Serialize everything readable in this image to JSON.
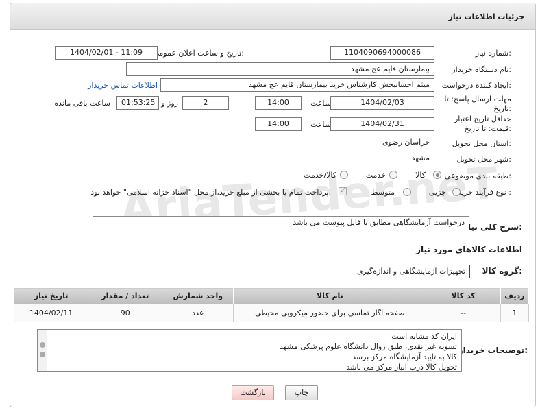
{
  "panel": {
    "title": "جزئیات اطلاعات نیاز"
  },
  "labels": {
    "need_number": "شماره نیاز:",
    "announce_datetime": "تاریخ و ساعت اعلان عمومی:",
    "buyer_org": "نام دستگاه خریدار:",
    "requester": "ایجاد کننده درخواست:",
    "reply_deadline": "مهلت ارسال پاسخ: تا تاریخ:",
    "price_validity": "حداقل تاریخ اعتبار قیمت: تا تاریخ:",
    "time_word": "ساعت",
    "day_and": "روز و",
    "remaining": "ساعت باقی مانده",
    "province": "استان محل تحویل:",
    "city": "شهر محل تحویل:",
    "category": "طبقه بندی موضوعی:",
    "purchase_type": "نوع فرآیند خرید :",
    "description": "شرح کلی نیاز:",
    "items_header": "اطلاعات کالاهای مورد نیاز",
    "goods_group": "گروه کالا:",
    "buyer_notes": "توضیحات خریدار:"
  },
  "values": {
    "need_number": "1104090694000086",
    "announce_datetime": "1404/02/01 - 11:09",
    "buyer_org": "بیمارستان قایم  عج  مشهد",
    "requester": "میثم احسانبخش کارشناس خرید بیمارستان قایم  عج  مشهد",
    "contact_link": "اطلاعات تماس خریدار",
    "reply_date": "1404/02/03",
    "reply_time": "14:00",
    "reply_days": "2",
    "reply_remaining": "01:53:25",
    "validity_date": "1404/02/31",
    "validity_time": "14:00",
    "province": "خراسان رضوی",
    "city": "مشهد",
    "description": "درخواست آزمایشگاهی مطابق با فایل پیوست می باشد",
    "goods_group": "تجهیزات آزمایشگاهی و اندازه‌گیری"
  },
  "category_options": [
    "کالا",
    "خدمت",
    "کالا/خدمت"
  ],
  "category_selected": "کالا",
  "purchase_options": [
    "جزیی",
    "متوسط"
  ],
  "purchase_note": "پرداخت تمام یا بخشی از مبلغ خرید،از محل \"اسناد خزانه اسلامی\" خواهد بود.",
  "watermark": "AriaTender.neT",
  "table": {
    "headers": [
      "ردیف",
      "کد کالا",
      "نام کالا",
      "واحد شمارش",
      "تعداد / مقدار",
      "تاریخ نیاز"
    ],
    "rows": [
      [
        "1",
        "--",
        "صفحه آگار تماسی برای حضور میکروبی محیطی",
        "عدد",
        "90",
        "1404/02/11"
      ]
    ]
  },
  "notes_lines": [
    "ایران کد مشابه است",
    "تسویه غیر نقدی، طبق روال دانشگاه علوم پزشکی مشهد",
    "کالا به تایید آزمایشگاه مرکز برسد",
    "تحویل کالا درب انبار مرکز می باشد"
  ],
  "buttons": {
    "print": "چاپ",
    "back": "بازگشت"
  },
  "colors": {
    "link": "#1a55b0",
    "header_bg": "#dcdcdc",
    "back_button": "#f4caca"
  }
}
